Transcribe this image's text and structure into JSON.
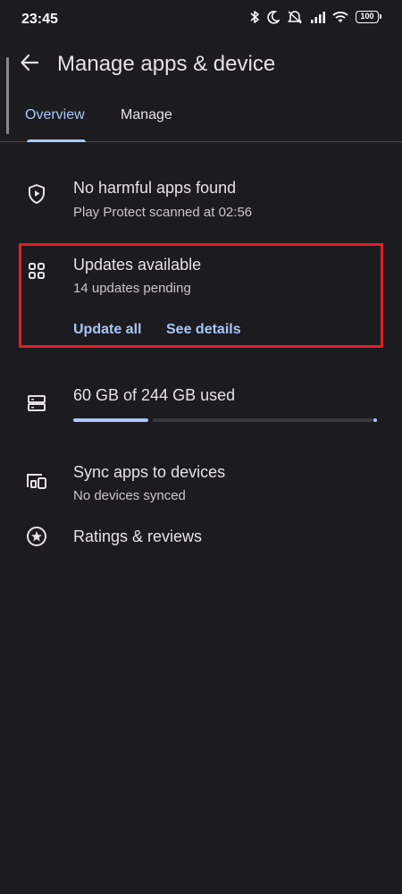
{
  "status_bar": {
    "time": "23:45",
    "battery": "100",
    "icons": [
      "bluetooth-icon",
      "moon-icon",
      "vibrate-off-icon",
      "signal-icon",
      "wifi-icon",
      "battery-icon"
    ]
  },
  "header": {
    "title": "Manage apps & device",
    "back_icon": "arrow-back-icon"
  },
  "tabs": [
    {
      "label": "Overview",
      "selected": true
    },
    {
      "label": "Manage",
      "selected": false
    }
  ],
  "overview": {
    "play_protect": {
      "title": "No harmful apps found",
      "subtitle": "Play Protect scanned at 02:56",
      "icon": "shield-play-icon"
    },
    "updates": {
      "title": "Updates available",
      "subtitle": "14 updates pending",
      "icon": "apps-grid-icon",
      "update_all": "Update all",
      "see_details": "See details"
    },
    "storage": {
      "title": "60 GB of 244 GB used",
      "used_gb": 60,
      "total_gb": 244,
      "icon": "storage-icon"
    },
    "sync": {
      "title": "Sync apps to devices",
      "subtitle": "No devices synced",
      "icon": "devices-icon"
    },
    "ratings": {
      "title": "Ratings & reviews",
      "icon": "star-circle-icon"
    }
  },
  "colors": {
    "background": "#1c1b1f",
    "accent": "#a8c7fa",
    "highlight_border": "#e01f28"
  }
}
